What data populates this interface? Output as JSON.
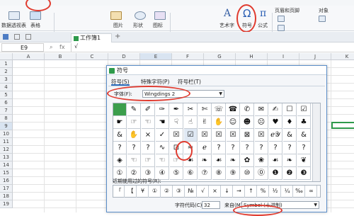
{
  "ribbon": {
    "items": [
      {
        "label": "数据透视表"
      },
      {
        "label": "表格"
      },
      {
        "label": "图片"
      },
      {
        "label": "形状"
      },
      {
        "label": "图标"
      },
      {
        "label": "艺术字"
      },
      {
        "label": "符号"
      },
      {
        "label": "公式"
      },
      {
        "label": "页眉和页脚"
      },
      {
        "label": "对象"
      }
    ]
  },
  "doc_tab": {
    "label": "工作簿1"
  },
  "formula_bar": {
    "cell_ref": "E9",
    "fx": "fx",
    "check": "√"
  },
  "sheet": {
    "columns": [
      "A",
      "B",
      "C",
      "D",
      "E",
      "F",
      "G",
      "H",
      "I",
      "J",
      "K"
    ],
    "rows": [
      "1",
      "2",
      "3",
      "4",
      "5",
      "6",
      "7",
      "8",
      "9",
      "10",
      "11",
      "12",
      "13",
      "14",
      "15",
      "16",
      "17",
      "18",
      "19"
    ]
  },
  "dialog": {
    "title": "符号",
    "tabs": [
      "符号(S)",
      "特殊字符(P)",
      "符号栏(T)"
    ],
    "font_label": "字体(F):",
    "font_value": "Wingdings 2",
    "symbol_rows": [
      [
        "",
        "✎",
        "✐",
        "✑",
        "✒",
        "✂",
        "✄",
        "☏",
        "☎",
        "✆",
        "✉",
        "✍",
        "☐",
        "☑"
      ],
      [
        "☛",
        "☞",
        "☜",
        "☚",
        "☟",
        "☝",
        "✌",
        "✋",
        "☺",
        "☻",
        "☹",
        "♥",
        "♦",
        "♣"
      ],
      [
        "&",
        "✋",
        "×",
        "✓",
        "☒",
        "☑",
        "☒",
        "☒",
        "☒",
        "⊠",
        "☒",
        "ℯ𝒴",
        "&",
        "&"
      ],
      [
        "?",
        "?",
        "?",
        "∿",
        "⊡",
        "≈",
        "ℯ",
        "?",
        "?",
        "?",
        "?",
        "?",
        "?",
        "?"
      ],
      [
        "◈",
        "☜",
        "☞",
        "☜",
        "☞",
        "☙",
        "❧",
        "☙",
        "❧",
        "✿",
        "❀",
        "☙",
        "❧",
        "❦"
      ],
      [
        "①",
        "②",
        "③",
        "④",
        "⑤",
        "⑥",
        "⑦",
        "⑧",
        "⑨",
        "⑩",
        "⓪",
        "❶",
        "❷",
        "❸"
      ]
    ],
    "recent_label": "近期使用过的符号(R):",
    "recent": [
      "「",
      "【",
      "¥",
      "①",
      "②",
      "③",
      "№",
      "√",
      "×",
      "↓",
      "→",
      "↑",
      "%",
      "½",
      "¼",
      "‰",
      "∞"
    ],
    "code_label": "字符代码(C):",
    "code_value": "32",
    "from_label": "来自(M):",
    "from_value": "Symbol (十进制)"
  }
}
